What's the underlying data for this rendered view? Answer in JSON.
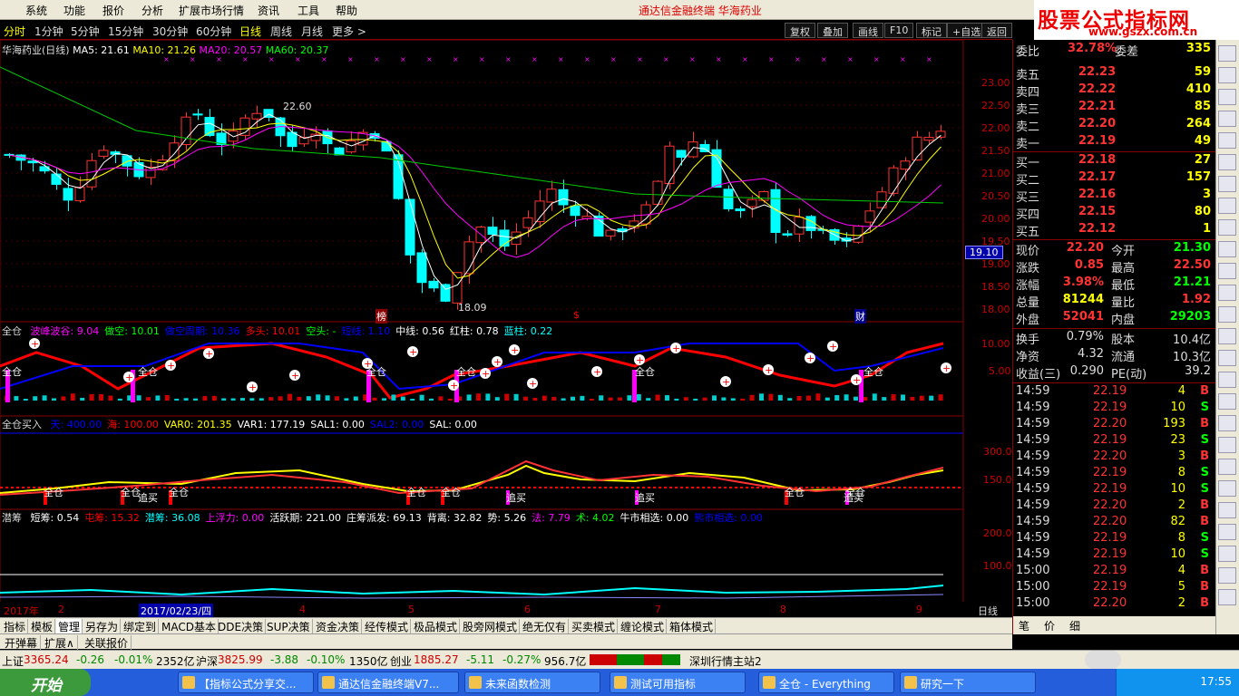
{
  "menu": [
    "系统",
    "功能",
    "报价",
    "分析",
    "扩展市场行情",
    "资讯",
    "工具",
    "帮助"
  ],
  "brand_title": "通达信金融终端    华海药业",
  "logo": {
    "line1": "股票公式指标网",
    "line2": "www.gszx.com.cn"
  },
  "periods": [
    "分时",
    "1分钟",
    "5分钟",
    "15分钟",
    "30分钟",
    "60分钟",
    "日线",
    "周线",
    "月线",
    "更多 >"
  ],
  "active_period": "日线",
  "tools": [
    "复权",
    "叠加",
    "画线",
    "F10",
    "标记",
    "+自选",
    "返回"
  ],
  "main_legend": {
    "name": "华海药业(日线)",
    "ma5": "MA5: 21.61",
    "ma10": "MA10: 21.26",
    "ma20": "MA20: 20.57",
    "ma60": "MA60: 20.37"
  },
  "price_axis": [
    "23.00",
    "22.50",
    "22.00",
    "21.50",
    "21.00",
    "20.50",
    "20.00",
    "19.50",
    "19.00",
    "18.50",
    "18.00"
  ],
  "current_price_tag": "19.10",
  "annotations": {
    "high": "22.60",
    "low": "18.09",
    "m1": "榜",
    "m2": "$",
    "m3": "财"
  },
  "ind1": {
    "title": "全仓",
    "items": [
      [
        "波峰波谷: 9.04",
        "#f0f"
      ],
      [
        "做空: 10.01",
        "#0f0"
      ],
      [
        "做空周期: 10.36",
        "#00f"
      ],
      [
        "多头: 10.01",
        "#f00"
      ],
      [
        "空头: -",
        "#0f0"
      ],
      [
        "短线: 1.10",
        "#00f"
      ],
      [
        "中线: 0.56",
        "#fff"
      ],
      [
        "红柱: 0.78",
        "#fff"
      ],
      [
        "蓝柱: 0.22",
        "#0ff"
      ]
    ],
    "axis": [
      "10.00",
      "5.00"
    ],
    "marker": "全仓"
  },
  "ind2": {
    "title": "全仓买入",
    "items": [
      [
        "天: 400.00",
        "#00f"
      ],
      [
        "海: 100.00",
        "#f00"
      ],
      [
        "VAR0: 201.35",
        "#ff0"
      ],
      [
        "VAR1: 177.19",
        "#fff"
      ],
      [
        "SAL1: 0.00",
        "#fff"
      ],
      [
        "SAL2: 0.00",
        "#00f"
      ],
      [
        "SAL: 0.00",
        "#fff"
      ]
    ],
    "axis": [
      "300.0",
      "150.0"
    ],
    "marker1": "全仓",
    "marker2": "追买"
  },
  "ind3": {
    "title": "潜筹",
    "items": [
      [
        "短筹: 0.54",
        "#fff"
      ],
      [
        "屯筹: 15.32",
        "#f00"
      ],
      [
        "潜筹: 36.08",
        "#0ff"
      ],
      [
        "上浮力: 0.00",
        "#f0f"
      ],
      [
        "活跃期: 221.00",
        "#fff"
      ],
      [
        "庄筹派发: 69.13",
        "#fff"
      ],
      [
        "背离: 32.82",
        "#fff"
      ],
      [
        "势: 5.26",
        "#fff"
      ],
      [
        "法: 7.79",
        "#f0f"
      ],
      [
        "术: 4.02",
        "#0f0"
      ],
      [
        "牛市相选: 0.00",
        "#fff"
      ],
      [
        "熊市相选: 0.00",
        "#00f"
      ]
    ],
    "axis": [
      "200.0",
      "100.0"
    ]
  },
  "date_axis": {
    "year": "2017年",
    "m2": "2",
    "cursor": "2017/02/23/四",
    "m4": "4",
    "m5": "5",
    "m6": "6",
    "m7": "7",
    "m8": "8",
    "m9": "9",
    "period": "日线"
  },
  "quote": {
    "wei": {
      "label": "委比",
      "value": "32.78%",
      "label2": "委差",
      "value2": "335"
    },
    "sells": [
      [
        "卖五",
        "22.23",
        "59"
      ],
      [
        "卖四",
        "22.22",
        "410"
      ],
      [
        "卖三",
        "22.21",
        "85"
      ],
      [
        "卖二",
        "22.20",
        "264"
      ],
      [
        "卖一",
        "22.19",
        "49"
      ]
    ],
    "buys": [
      [
        "买一",
        "22.18",
        "27"
      ],
      [
        "买二",
        "22.17",
        "157"
      ],
      [
        "买三",
        "22.16",
        "3"
      ],
      [
        "买四",
        "22.15",
        "80"
      ],
      [
        "买五",
        "22.12",
        "1"
      ]
    ],
    "stats": [
      [
        "现价",
        "22.20",
        "今开",
        "21.30"
      ],
      [
        "涨跌",
        "0.85",
        "最高",
        "22.50"
      ],
      [
        "涨幅",
        "3.98%",
        "最低",
        "21.21"
      ],
      [
        "总量",
        "81244",
        "量比",
        "1.92"
      ],
      [
        "外盘",
        "52041",
        "内盘",
        "29203"
      ]
    ],
    "stats2": [
      [
        "换手",
        "0.79%",
        "股本",
        "10.4亿"
      ],
      [
        "净资",
        "4.32",
        "流通",
        "10.3亿"
      ],
      [
        "收益(三)",
        "0.290",
        "PE(动)",
        "39.2"
      ]
    ]
  },
  "ticks": [
    [
      "14:59",
      "22.19",
      "4",
      "B"
    ],
    [
      "14:59",
      "22.19",
      "10",
      "S"
    ],
    [
      "14:59",
      "22.20",
      "193",
      "B"
    ],
    [
      "14:59",
      "22.19",
      "23",
      "S"
    ],
    [
      "14:59",
      "22.20",
      "3",
      "B"
    ],
    [
      "14:59",
      "22.19",
      "8",
      "S"
    ],
    [
      "14:59",
      "22.19",
      "10",
      "S"
    ],
    [
      "14:59",
      "22.20",
      "2",
      "B"
    ],
    [
      "14:59",
      "22.20",
      "82",
      "B"
    ],
    [
      "14:59",
      "22.19",
      "8",
      "S"
    ],
    [
      "14:59",
      "22.19",
      "10",
      "S"
    ],
    [
      "15:00",
      "22.19",
      "4",
      "B"
    ],
    [
      "15:00",
      "22.19",
      "5",
      "B"
    ],
    [
      "15:00",
      "22.20",
      "2",
      "B"
    ]
  ],
  "right_tabs": [
    "笔",
    "价",
    "细"
  ],
  "tabs1": [
    "指标",
    "模板",
    "管理",
    "另存为",
    "绑定到",
    "MACD基本",
    "DDE决策",
    "SUP决策",
    "资金决策",
    "经传模式",
    "极品模式",
    "股旁网模式",
    "绝无仅有",
    "买卖模式",
    "缠论模式",
    "箱体模式"
  ],
  "tabs1_selected": "管理",
  "tabs2": [
    "开弹幕",
    "扩展∧",
    "关联报价"
  ],
  "indexbar": {
    "sh_label": "上证",
    "sh": "3365.24",
    "sh_chg": "-0.26",
    "sh_pct": "-0.01%",
    "sh_amt": "2352亿",
    "hs_label": "沪深",
    "hs": "3825.99",
    "hs_chg": "-3.88",
    "hs_pct": "-0.10%",
    "hs_amt": "1350亿",
    "cy_label": "创业",
    "cy": "1885.27",
    "cy_chg": "-5.11",
    "cy_pct": "-0.27%",
    "cy_amt": "956.7亿",
    "server": "深圳行情主站2"
  },
  "taskbar": {
    "start": "开始",
    "items": [
      "【指标公式分享交...",
      "通达信金融终端V7...",
      "未来函数检测",
      "测试可用指标",
      "全仓 - Everything",
      "研究一下"
    ],
    "clock": "17:55"
  }
}
